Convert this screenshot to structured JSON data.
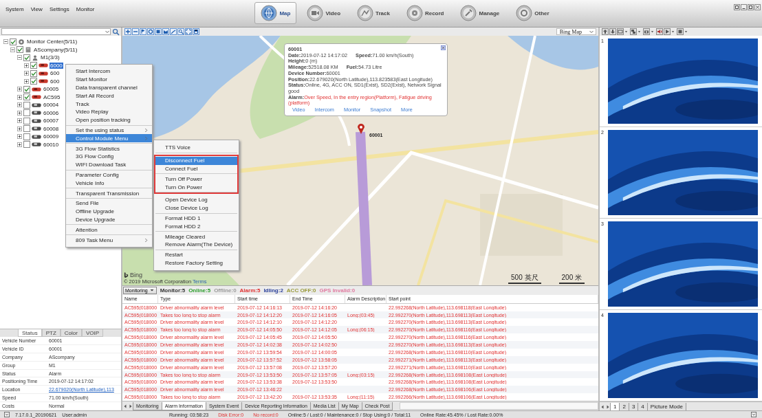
{
  "menu_bar": [
    "System",
    "View",
    "Settings",
    "Monitor"
  ],
  "nav_buttons": [
    {
      "label": "Map",
      "kind": "map",
      "selected": true
    },
    {
      "label": "Video",
      "kind": "video",
      "selected": false
    },
    {
      "label": "Track",
      "kind": "track",
      "selected": false
    },
    {
      "label": "Record",
      "kind": "record",
      "selected": false
    },
    {
      "label": "Manage",
      "kind": "manage",
      "selected": false
    },
    {
      "label": "Other",
      "kind": "other",
      "selected": false
    }
  ],
  "tree": [
    {
      "label": "Monitor Center(5/11)",
      "kind": "center",
      "checked": true,
      "expanded": true,
      "children": [
        {
          "label": "AScompany(5/11)",
          "kind": "company",
          "checked": true,
          "expanded": true,
          "children": [
            {
              "label": "M1(3/3)",
              "kind": "group",
              "checked": true,
              "expanded": true,
              "children": [
                {
                  "label": "6000",
                  "kind": "vehicle",
                  "checked": true,
                  "expanded": false,
                  "online": true,
                  "selected": true
                },
                {
                  "label": "600",
                  "kind": "vehicle",
                  "checked": true,
                  "expanded": false,
                  "online": true,
                  "selected": false
                },
                {
                  "label": "600",
                  "kind": "vehicle",
                  "checked": true,
                  "expanded": false,
                  "online": true,
                  "selected": false
                }
              ]
            },
            {
              "label": "60005",
              "kind": "vehicle",
              "checked": true,
              "expanded": false,
              "online": true,
              "selected": false
            },
            {
              "label": "AC595",
              "kind": "vehicle",
              "checked": true,
              "expanded": false,
              "online": true,
              "selected": false
            },
            {
              "label": "60004",
              "kind": "vehicle",
              "checked": false,
              "expanded": false,
              "online": false,
              "selected": false
            },
            {
              "label": "60006",
              "kind": "vehicle",
              "checked": false,
              "expanded": false,
              "online": false,
              "selected": false
            },
            {
              "label": "60007",
              "kind": "vehicle",
              "checked": false,
              "expanded": false,
              "online": false,
              "selected": false
            },
            {
              "label": "60008",
              "kind": "vehicle",
              "checked": false,
              "expanded": false,
              "online": false,
              "selected": false
            },
            {
              "label": "60009",
              "kind": "vehicle",
              "checked": false,
              "expanded": false,
              "online": false,
              "selected": false
            },
            {
              "label": "60010",
              "kind": "vehicle",
              "checked": false,
              "expanded": false,
              "online": false,
              "selected": false
            }
          ]
        }
      ]
    }
  ],
  "vehicle_panel": {
    "tabs": [
      {
        "label": "Status",
        "selected": true
      },
      {
        "label": "PTZ",
        "selected": false
      },
      {
        "label": "Color",
        "selected": false
      },
      {
        "label": "VOIP",
        "selected": false
      }
    ],
    "rows": [
      {
        "label": "Vehicle Number",
        "value": "60001"
      },
      {
        "label": "Vehicle ID",
        "value": "60001"
      },
      {
        "label": "Company",
        "value": "AScompany"
      },
      {
        "label": "Group",
        "value": "M1"
      },
      {
        "label": "Status",
        "value": "Alarm"
      },
      {
        "label": "Positioning Time",
        "value": "2019-07-12 14:17:02"
      },
      {
        "label": "Location",
        "value": "22.679020(North Latitude),113",
        "kind": "link"
      },
      {
        "label": "Speed",
        "value": "71.00 km/h(South)"
      },
      {
        "label": "Costs",
        "value": "Normal"
      }
    ]
  },
  "map": {
    "layer": "Bing Map",
    "marker": {
      "label": "60001"
    },
    "popup": {
      "title": "60001",
      "lines": [
        [
          {
            "label": "Date:",
            "value": "2019-07-12 14:17:02"
          },
          {
            "label": "Speed:",
            "value": "71.00 km/h(South)"
          }
        ],
        [
          {
            "label": "Height:",
            "value": "0 (m)"
          }
        ],
        [
          {
            "label": "Mileage:",
            "value": "52518.08 KM"
          },
          {
            "label": "Fuel:",
            "value": "54.73 Litre"
          }
        ],
        [
          {
            "label": "Device Number:",
            "value": "60001"
          }
        ],
        [
          {
            "label": "Position:",
            "value": "22.679020(North Latitude),113.823583(East Longitude)"
          }
        ],
        [
          {
            "label": "Status:",
            "value": "Online, 4G, ACC ON, SD1(Exist), SD2(Exist), Network Signal good"
          }
        ],
        [
          {
            "label": "Alarm:",
            "value": "Over Speed, In the entry region(Platform), Fatigue driving (platform)",
            "kind": "alarm"
          }
        ]
      ],
      "links": [
        "Video",
        "Intercom",
        "Monitor",
        "Snapshot",
        "More"
      ]
    },
    "attribution": {
      "logo": "Bing",
      "copyright": "© 2019 Microsoft Corporation",
      "terms": "Terms"
    },
    "scale": [
      "500 英尺",
      "200 米"
    ]
  },
  "context_menu": {
    "groups": [
      [
        {
          "label": "Start Intercom",
          "submenu": false,
          "selected": false
        },
        {
          "label": "Start Monitor",
          "submenu": false,
          "selected": false
        },
        {
          "label": "Data transparent channel",
          "submenu": false,
          "selected": false
        },
        {
          "label": "Start All Record",
          "submenu": false,
          "selected": false
        },
        {
          "label": "Track",
          "submenu": false,
          "selected": false
        },
        {
          "label": "Video Replay",
          "submenu": false,
          "selected": false
        },
        {
          "label": "Open position tracking",
          "submenu": false,
          "selected": false
        }
      ],
      [
        {
          "label": "Set the using status",
          "submenu": true,
          "selected": false
        },
        {
          "label": "Control Module Menu",
          "submenu": true,
          "selected": true
        }
      ],
      [
        {
          "label": "3G Flow Statistics",
          "submenu": false,
          "selected": false
        },
        {
          "label": "3G Flow Config",
          "submenu": false,
          "selected": false
        },
        {
          "label": "WIFI Download Task",
          "submenu": false,
          "selected": false
        }
      ],
      [
        {
          "label": "Parameter Config",
          "submenu": false,
          "selected": false
        },
        {
          "label": "Vehicle Info",
          "submenu": false,
          "selected": false
        }
      ],
      [
        {
          "label": "Transparent Transmission",
          "submenu": false,
          "selected": false
        }
      ],
      [
        {
          "label": "Send File",
          "submenu": false,
          "selected": false
        },
        {
          "label": "Offline Upgrade",
          "submenu": false,
          "selected": false
        },
        {
          "label": "Device Upgrade",
          "submenu": false,
          "selected": false
        }
      ],
      [
        {
          "label": "Attention",
          "submenu": false,
          "selected": false
        }
      ],
      [
        {
          "label": "809 Task Menu",
          "submenu": true,
          "selected": false
        }
      ]
    ]
  },
  "submenu": {
    "sections": [
      {
        "highlighted": false,
        "groups": [
          [
            {
              "label": "TTS Voice",
              "selected": false
            }
          ]
        ]
      },
      {
        "highlighted": true,
        "groups": [
          [
            {
              "label": "Disconnect Fuel",
              "selected": true
            },
            {
              "label": "Connect Fuel",
              "selected": false
            }
          ],
          [
            {
              "label": "Turn Off Power",
              "selected": false
            },
            {
              "label": "Turn On Power",
              "selected": false
            }
          ]
        ]
      },
      {
        "highlighted": false,
        "groups": [
          [
            {
              "label": "Open Device Log",
              "selected": false
            },
            {
              "label": "Close Device Log",
              "selected": false
            }
          ],
          [
            {
              "label": "Format HDD 1",
              "selected": false
            },
            {
              "label": "Format HDD 2",
              "selected": false
            }
          ],
          [
            {
              "label": "Mileage Cleared",
              "selected": false
            },
            {
              "label": "Remove Alarm(The Device)",
              "selected": false
            }
          ],
          [
            {
              "label": "Restart",
              "selected": false
            },
            {
              "label": "Restore Factory Setting",
              "selected": false
            }
          ]
        ]
      }
    ]
  },
  "monitor_bar": {
    "mode": "Monitoring",
    "counts": [
      {
        "label": "Monitor:5",
        "color": "#333333"
      },
      {
        "label": "Online:5",
        "color": "#2a9d2a"
      },
      {
        "label": "Offline:0",
        "color": "#9a9a9a"
      },
      {
        "label": "Alarm:5",
        "color": "#e03030"
      },
      {
        "label": "Idling:2",
        "color": "#2a3f9a"
      },
      {
        "label": "ACC OFF:0",
        "color": "#9a9a3a"
      },
      {
        "label": "GPS Invalid:0",
        "color": "#e07aa0"
      }
    ]
  },
  "alarm_table": {
    "columns": [
      "Name",
      "Type",
      "Start time",
      "End Time",
      "Alarm Description",
      "Start point"
    ],
    "rows": [
      {
        "name": "AC595(018000",
        "type": "Driver abnormality alarm level",
        "start": "2019-07-12 14:16:13",
        "end": "2019-07-12 14:16:20",
        "point": "22.992268(North Latitude),113.698118(East Longitude)"
      },
      {
        "name": "AC595(018000",
        "type": "Takes too long to stop alarm",
        "start": "2019-07-12 14:12:20",
        "end": "2019-07-12 14:16:05",
        "description": "Long:(03:45)",
        "point": "22.992270(North Latitude),113.698113(East Longitude)"
      },
      {
        "name": "AC595(018000",
        "type": "Driver abnormality alarm level",
        "start": "2019-07-12 14:12:10",
        "end": "2019-07-12 14:12:20",
        "point": "22.992270(North Latitude),113.698113(East Longitude)"
      },
      {
        "name": "AC595(018000",
        "type": "Takes too long to stop alarm",
        "start": "2019-07-12 14:05:50",
        "end": "2019-07-12 14:12:05",
        "description": "Long:(06:15)",
        "point": "22.992270(North Latitude),113.698116(East Longitude)"
      },
      {
        "name": "AC595(018000",
        "type": "Driver abnormality alarm level",
        "start": "2019-07-12 14:05:45",
        "end": "2019-07-12 14:05:50",
        "point": "22.992270(North Latitude),113.698116(East Longitude)"
      },
      {
        "name": "AC595(018000",
        "type": "Driver abnormality alarm level",
        "start": "2019-07-12 14:02:38",
        "end": "2019-07-12 14:02:50",
        "point": "22.992270(North Latitude),113.698113(East Longitude)"
      },
      {
        "name": "AC595(018000",
        "type": "Driver abnormality alarm level",
        "start": "2019-07-12 13:59:54",
        "end": "2019-07-12 14:00:05",
        "point": "22.992268(North Latitude),113.698110(East Longitude)"
      },
      {
        "name": "AC595(018000",
        "type": "Driver abnormality alarm level",
        "start": "2019-07-12 13:57:52",
        "end": "2019-07-12 13:58:05",
        "point": "22.992271(North Latitude),113.698113(East Longitude)"
      },
      {
        "name": "AC595(018000",
        "type": "Driver abnormality alarm level",
        "start": "2019-07-12 13:57:08",
        "end": "2019-07-12 13:57:20",
        "point": "22.992271(North Latitude),113.698110(East Longitude)"
      },
      {
        "name": "AC595(018000",
        "type": "Takes too long to stop alarm",
        "start": "2019-07-12 13:53:50",
        "end": "2019-07-12 13:57:05",
        "description": "Long:(03:15)",
        "point": "22.992268(North Latitude),113.698108(East Longitude)"
      },
      {
        "name": "AC595(018000",
        "type": "Driver abnormality alarm level",
        "start": "2019-07-12 13:53:38",
        "end": "2019-07-12 13:53:50",
        "point": "22.992268(North Latitude),113.698108(East Longitude)"
      },
      {
        "name": "AC595(018000",
        "type": "Driver abnormality alarm level",
        "start": "2019-07-12 13:46:22",
        "point": "22.992268(North Latitude),113.698106(East Longitude)"
      },
      {
        "name": "AC595(018000",
        "type": "Takes too long to stop alarm",
        "start": "2019-07-12 13:42:20",
        "end": "2019-07-12 13:53:35",
        "description": "Long:(11:15)",
        "point": "22.992266(North Latitude),113.698106(East Longitude)"
      }
    ]
  },
  "bottom_tabs": [
    {
      "label": "Monitoring",
      "selected": false
    },
    {
      "label": "Alarm Information",
      "selected": true
    },
    {
      "label": "System Event",
      "selected": false
    },
    {
      "label": "Device Reporting Information",
      "selected": false
    },
    {
      "label": "Media List",
      "selected": false
    },
    {
      "label": "My Map",
      "selected": false
    },
    {
      "label": "Check Post",
      "selected": false
    }
  ],
  "video_panel": {
    "cells": [
      "1",
      "2",
      "3",
      "4"
    ],
    "tabs": [
      {
        "label": "1",
        "selected": true
      },
      {
        "label": "2",
        "selected": false
      },
      {
        "label": "3",
        "selected": false
      },
      {
        "label": "4",
        "selected": false
      },
      {
        "label": "Picture Mode",
        "selected": false
      }
    ]
  },
  "status_bar": {
    "version": "7.17.0.1_20190621",
    "user": "User:admin",
    "items": [
      {
        "label": "Running: 03:58:23",
        "kind": "normal"
      },
      {
        "label": "Disk Error:0",
        "kind": "error"
      },
      {
        "label": "No record:0",
        "kind": "error"
      },
      {
        "label": "Online:5 / Lost:0 / Maintenance:0 / Stop Using:0 / Total:11",
        "kind": "normal"
      },
      {
        "label": "Online Rate:45.45% / Lost Rate:0.00%",
        "kind": "normal"
      }
    ]
  }
}
